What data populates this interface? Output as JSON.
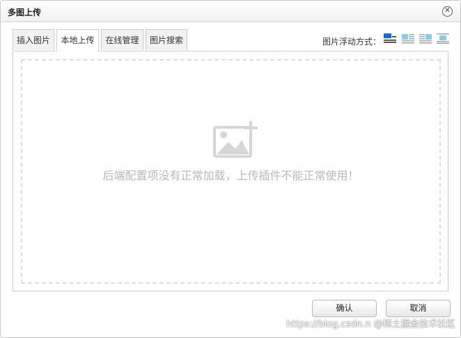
{
  "dialog": {
    "title": "多图上传",
    "close_glyph": "✕"
  },
  "tabs": [
    {
      "label": "插入图片",
      "active": false
    },
    {
      "label": "本地上传",
      "active": true
    },
    {
      "label": "在线管理",
      "active": false
    },
    {
      "label": "图片搜索",
      "active": false
    }
  ],
  "float_options": {
    "label": "图片浮动方式：",
    "icons": [
      "float-none-icon",
      "float-left-icon",
      "float-right-icon",
      "float-center-icon"
    ],
    "selected": "float-none-icon"
  },
  "upload_area": {
    "icon": "image-add-icon",
    "message": "后端配置项没有正常加载，上传插件不能正常使用！"
  },
  "buttons": {
    "confirm": "确认",
    "cancel": "取消"
  },
  "watermark": "https://blog.csdn.n @稀土掘金技术社区",
  "colors": {
    "accent": "#1a6fc2",
    "dashed_border": "#dcdcdc",
    "message_text": "#b8b8b8"
  }
}
